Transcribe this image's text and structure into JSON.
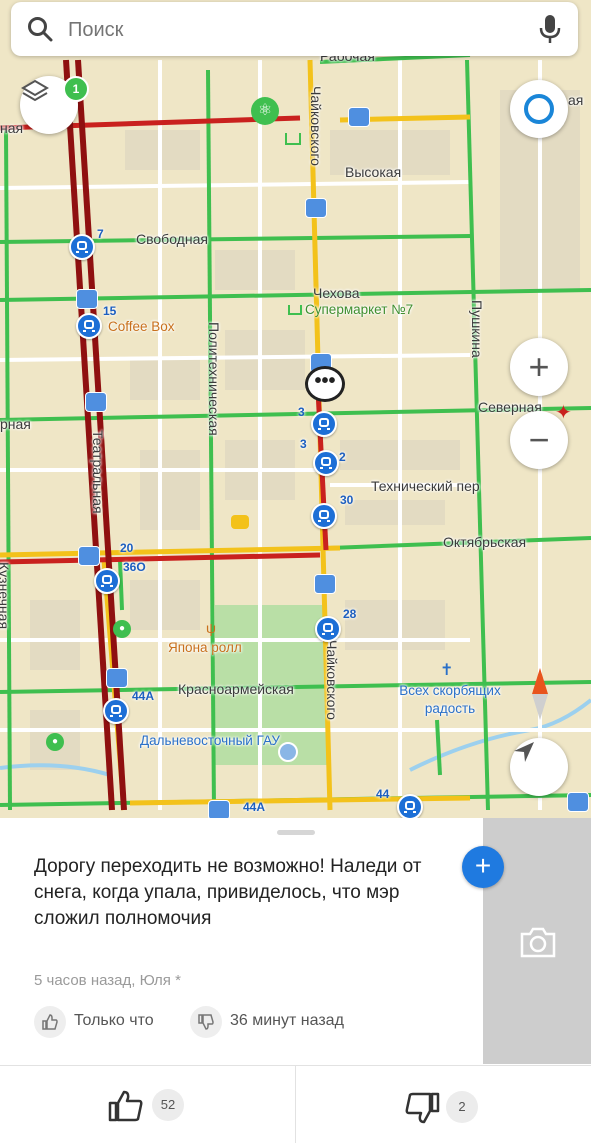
{
  "search": {
    "placeholder": "Поиск"
  },
  "map": {
    "layers_badge": "1",
    "streets": {
      "rabochaya": "Рабочая",
      "vysokaya": "Высокая",
      "svobodnaya": "Свободная",
      "chekhova": "Чехова",
      "severnaya": "Северная",
      "tekhnicheskiy": "Технический пер",
      "oktyabrskaya": "Октябрьская",
      "krasnoarmeyskaya": "Красноармейская",
      "chaykovskogo_top": "Чайковского",
      "chaykovskogo_bottom": "Чайковского",
      "politekhnicheskaya": "Политехническая",
      "pushkina": "Пушкина",
      "teatralnaya": "Театральная",
      "kuznechnaya": "Кузнечная",
      "left_na": "ная",
      "left_rnaya": "рная",
      "right_aya": "ая"
    },
    "pois": {
      "coffee_box": "Coffee Box",
      "supermarket": "Супермаркет №7",
      "yapona": "Япона ролл",
      "church": "Всех скорбящих радость",
      "gau": "Дальневосточный ГАУ"
    },
    "routes": {
      "r7": "7",
      "r15": "15",
      "r3a": "3",
      "r3b": "3",
      "r2": "2",
      "r30": "30",
      "r20": "20",
      "r36o": "36О",
      "r28": "28",
      "r44a_1": "44А",
      "r44a_2": "44А",
      "r44": "44"
    },
    "traffic_colors": {
      "green": "#3fbf4f",
      "yellow": "#f3c21b",
      "red": "#c9211e",
      "darkred": "#8f1010"
    }
  },
  "post": {
    "text": "Дорогу переходить не возможно! Наледи от снега, когда упала, привиделось, что мэр сложил полномочия",
    "meta": "5 часов назад, Юля *",
    "like_time": "Только что",
    "dislike_time": "36 минут назад"
  },
  "votes": {
    "likes": "52",
    "dislikes": "2"
  }
}
